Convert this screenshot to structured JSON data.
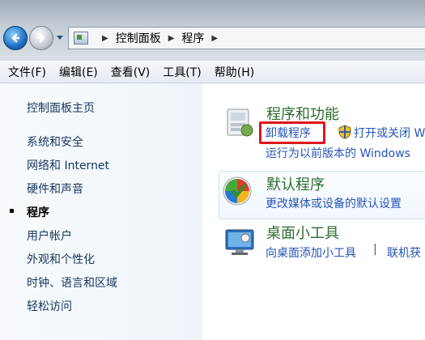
{
  "address_bar": {
    "crumbs": [
      "控制面板",
      "程序"
    ]
  },
  "menu": {
    "items": [
      "文件(F)",
      "编辑(E)",
      "查看(V)",
      "工具(T)",
      "帮助(H)"
    ]
  },
  "sidebar": {
    "home": "控制面板主页",
    "items": [
      "系统和安全",
      "网络和 Internet",
      "硬件和声音",
      "程序",
      "用户帐户",
      "外观和个性化",
      "时钟、语言和区域",
      "轻松访问"
    ],
    "active_index": 3
  },
  "categories": [
    {
      "title": "程序和功能",
      "links": [
        "卸载程序",
        "打开或关闭 W",
        "运行为以前版本的 Windows"
      ],
      "icon": "programs-features-icon"
    },
    {
      "title": "默认程序",
      "links": [
        "更改媒体或设备的默认设置"
      ],
      "icon": "default-programs-icon"
    },
    {
      "title": "桌面小工具",
      "links": [
        "向桌面添加小工具",
        "联机获"
      ],
      "icon": "desktop-gadgets-icon"
    }
  ],
  "colors": {
    "highlight": "#e0161d",
    "link": "#2455b7",
    "category_title": "#2c6b2f"
  }
}
